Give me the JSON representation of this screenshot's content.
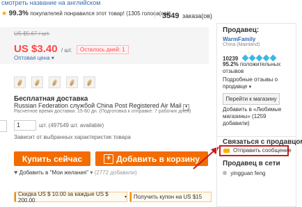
{
  "header": {
    "english_title_link": "смотреть название на английском",
    "rating_value": "99.3%",
    "rating_text": "покупателей понравился этот товар! (1305 голоса(ов))",
    "orders_count": "3549",
    "orders_label": "заказа(ов)"
  },
  "price": {
    "old_price": "US $5.67 / шт.",
    "current_price": "US $3.40",
    "unit": "/ шт.",
    "days_left_badge": "Осталось дней: 1",
    "wholesale_link": "Оптовая цена"
  },
  "shipping": {
    "title": "Бесплатная доставка",
    "method": "Russian Federation службой China Post Registered Air Mail",
    "estimated": "Расчетное время доставки: 15-60 дн. (Подготовка к отправке: 7 рабочих дней)"
  },
  "quantity": {
    "value": "1",
    "unit_note": "шт. (497549 шт. available)",
    "depends_note": "Зависит от выбранных характеристик товара"
  },
  "actions": {
    "buy_now": "Купить сейчас",
    "add_to_cart": "Добавить в корзину",
    "wishlist": "Добавить в \"Мои желания\"",
    "wishlist_count": "(2772 добавили)"
  },
  "coupons": {
    "discount": "Скидка US $ 10.00 за каждые US $ 200.00",
    "get_coupon": "Получить купон на US $15"
  },
  "seller": {
    "label": "Продавец:",
    "name": "WarmFamily",
    "country": "China (Mainland)",
    "score": "10239",
    "positive_percent": "95.2%",
    "positive_text": "положительных отзывов",
    "detailed_reviews": "Подробные отзывы о продавце",
    "store_button": "Перейти к магазину",
    "favorites_text": "Добавить в «Любимые магазины» (1259 добавили)"
  },
  "contact": {
    "title": "Связаться с продавцом",
    "send_message": "Отправить сообщение",
    "online_title": "Продавец в сети",
    "online_user": "yingguan feng"
  },
  "colors": {
    "accent": "#ff4747",
    "orange": "#f36c00",
    "link": "#3a6cb2",
    "highlight_red": "#cc1a1a"
  }
}
